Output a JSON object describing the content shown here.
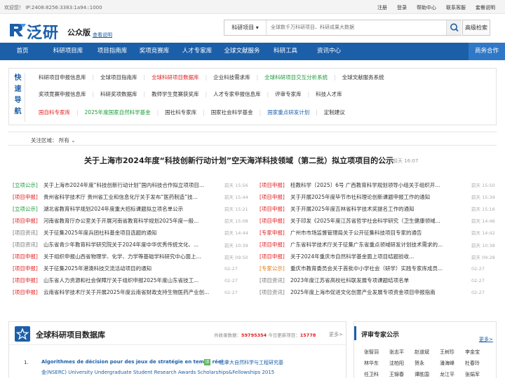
{
  "topbar": {
    "welcome": "欢迎您！ IP:2408:8256:3383:1a94::1000",
    "links": [
      "注册",
      "登录",
      "帮助中心",
      "联系客服",
      "套餐说明"
    ]
  },
  "header": {
    "logo_text": "泛研",
    "edition": "公众版",
    "edition_link": "查看说明",
    "search_category": "科研项目",
    "search_placeholder": "全球数千万科研项目、科研成果大数据",
    "advanced_search": "高级检索"
  },
  "nav": {
    "items": [
      "首页",
      "科研项目库",
      "项目指南库",
      "奖项竞赛库",
      "人才专家库",
      "全球文献服务",
      "科研工具",
      "资讯中心"
    ],
    "business": "商务合作"
  },
  "quick_nav": {
    "label": [
      "快",
      "速",
      "导",
      "航"
    ],
    "rows": [
      [
        {
          "text": "科研项目申报信息库",
          "color": "default"
        },
        {
          "text": "全球项目指南库",
          "color": "default"
        },
        {
          "text": "全球科研项目数据库",
          "color": "red"
        },
        {
          "text": "企业科技需求库",
          "color": "default"
        },
        {
          "text": "全球科研项目交互分析系统",
          "color": "green"
        },
        {
          "text": "全球文献服务系统",
          "color": "default"
        }
      ],
      [
        {
          "text": "奖项竞赛申报信息库",
          "color": "default"
        },
        {
          "text": "科研奖项数据库",
          "color": "default"
        },
        {
          "text": "教师学生竞赛获奖库",
          "color": "default"
        },
        {
          "text": "人才专家申报信息库",
          "color": "default"
        },
        {
          "text": "评审专家库",
          "color": "default"
        },
        {
          "text": "科技人才库",
          "color": "default"
        }
      ],
      [
        {
          "text": "国自科专家库",
          "color": "red"
        },
        {
          "text": "2025年度国家自然科学基金",
          "color": "green"
        },
        {
          "text": "国社科专家库",
          "color": "default"
        },
        {
          "text": "国家社会科学基金",
          "color": "default"
        },
        {
          "text": "国家重点研发计划",
          "color": "blue"
        },
        {
          "text": "定制建议",
          "color": "default"
        }
      ]
    ]
  },
  "area": {
    "label": "关注区域：",
    "value": "所有"
  },
  "headline": {
    "title": "关于上海市2024年度“科技创新行动计划”空天海洋科技领域（第二批）拟立项项目的公示",
    "date": "前天 16:07"
  },
  "news_left": [
    {
      "tag": "[立项公示]",
      "type": "green",
      "title": "关于上海市2024年度“科技创新行动计划”国内科技合作拟立项项目...",
      "date": "前天 15:56"
    },
    {
      "tag": "[项目申报]",
      "type": "red",
      "title": "贵州省科学技术厅 贵州省工业和信息化厅关于发布“医药制造”技...",
      "date": "前天 15:44"
    },
    {
      "tag": "[立项公示]",
      "type": "green",
      "title": "湖北省教育科学规划2024年度重大招标课题拟立项名单公示",
      "date": "前天 15:21"
    },
    {
      "tag": "[项目申报]",
      "type": "red",
      "title": "河南省教育厅办公室关于开展河南省教育科学规划2025年度一般...",
      "date": "前天 15:08"
    },
    {
      "tag": "[项目资讯]",
      "type": "gray",
      "title": "关于征集2025年度兵团社科基金项目选题的通知",
      "date": "前天 14:44"
    },
    {
      "tag": "[项目资讯]",
      "type": "gray",
      "title": "山东省青少年教育科学研究院关于2024年度中华优秀传统文化、...",
      "date": "前天 10:39"
    },
    {
      "tag": "[项目申报]",
      "type": "red",
      "title": "关于组织申报山西省物理学、化学、力学等基础学科研究中心面上...",
      "date": "前天 09:50"
    },
    {
      "tag": "[项目申报]",
      "type": "red",
      "title": "关于征集2025年港澳科技交流活动项目的通知",
      "date": "02-27"
    },
    {
      "tag": "[项目申报]",
      "type": "red",
      "title": "山东省人力资源和社会保障厅关于组织申报2025年度山东省技工...",
      "date": "02-27"
    },
    {
      "tag": "[项目申报]",
      "type": "red",
      "title": "云南省科学技术厅关于开展2025年度云南省财政支持生物医药产业创...",
      "date": "02-27"
    }
  ],
  "news_right": [
    {
      "tag": "[项目申报]",
      "type": "red",
      "title": "桂教科学〔2025〕6号 广西教育科学规划领导小组关于组织开...",
      "date": "前天 15:50"
    },
    {
      "tag": "[项目申报]",
      "type": "red",
      "title": "关于开展2025年度毕节市社科理论创新课题申报工作的通知",
      "date": "前天 15:39"
    },
    {
      "tag": "[项目申报]",
      "type": "red",
      "title": "关于开展2025年度吉林省科学技术奖提名工作的通知",
      "date": "前天 15:16"
    },
    {
      "tag": "[项目申报]",
      "type": "red",
      "title": "关于印发《2025年度江苏省哲学社会科学研究（卫生健康领域...",
      "date": "前天 14:46"
    },
    {
      "tag": "[专家申报]",
      "type": "red",
      "title": "广州市市场监督管理局关于公开征集科技项目专家的通告",
      "date": "前天 14:42"
    },
    {
      "tag": "[项目申报]",
      "type": "red",
      "title": "广东省科学技术厅关于征集广东省重点领域研发计划技术需求的...",
      "date": "前天 10:38"
    },
    {
      "tag": "[项目申报]",
      "type": "red",
      "title": "关于2024年重庆市自然科学基金面上项目结题验收...",
      "date": "前天 09:28"
    },
    {
      "tag": "[专家公示]",
      "type": "orange",
      "title": "重庆市教育委员会关于首批中小学社会（研学）实践专家库成员...",
      "date": "02-27"
    },
    {
      "tag": "[项目资讯]",
      "type": "gray",
      "title": "2023年度江苏省高校社科联发展专项课题结项名单",
      "date": "02-27"
    },
    {
      "tag": "[项目资讯]",
      "type": "gray",
      "title": "2025年度上海市促进文化创意产业发展专项资金项目申报指南",
      "date": "02-27"
    }
  ],
  "database": {
    "title": "全球科研项目数据库",
    "stats_prefix": "共收录数据：",
    "total": "59795354",
    "stats_mid": " 今日更新项目：",
    "today": "15778",
    "more": "更多>",
    "item": {
      "num": "1.",
      "title": "Algorithmes de décision pour des jeux de stratégie en temps réel",
      "icon": "译",
      "zh": "加拿大自然科学与工程研究基",
      "line2": "金(NSERC) University Undergraduate Student Research Awards Scholarships&Fellowships 2015"
    }
  },
  "experts": {
    "title": "评审专家公示",
    "more": "更多>",
    "names": [
      "张智羽",
      "张志平",
      "赵道斌",
      "王树珍",
      "李金宝",
      "林华东",
      "沈柏阳",
      "贺永",
      "潘海峰",
      "杜春玲",
      "任卫科",
      "王锦春",
      "谭胜国",
      "龙江平",
      "张娟军"
    ]
  },
  "colors": {
    "brand": "#1b5fa8",
    "red": "#e02020",
    "green": "#1a9a3a"
  }
}
